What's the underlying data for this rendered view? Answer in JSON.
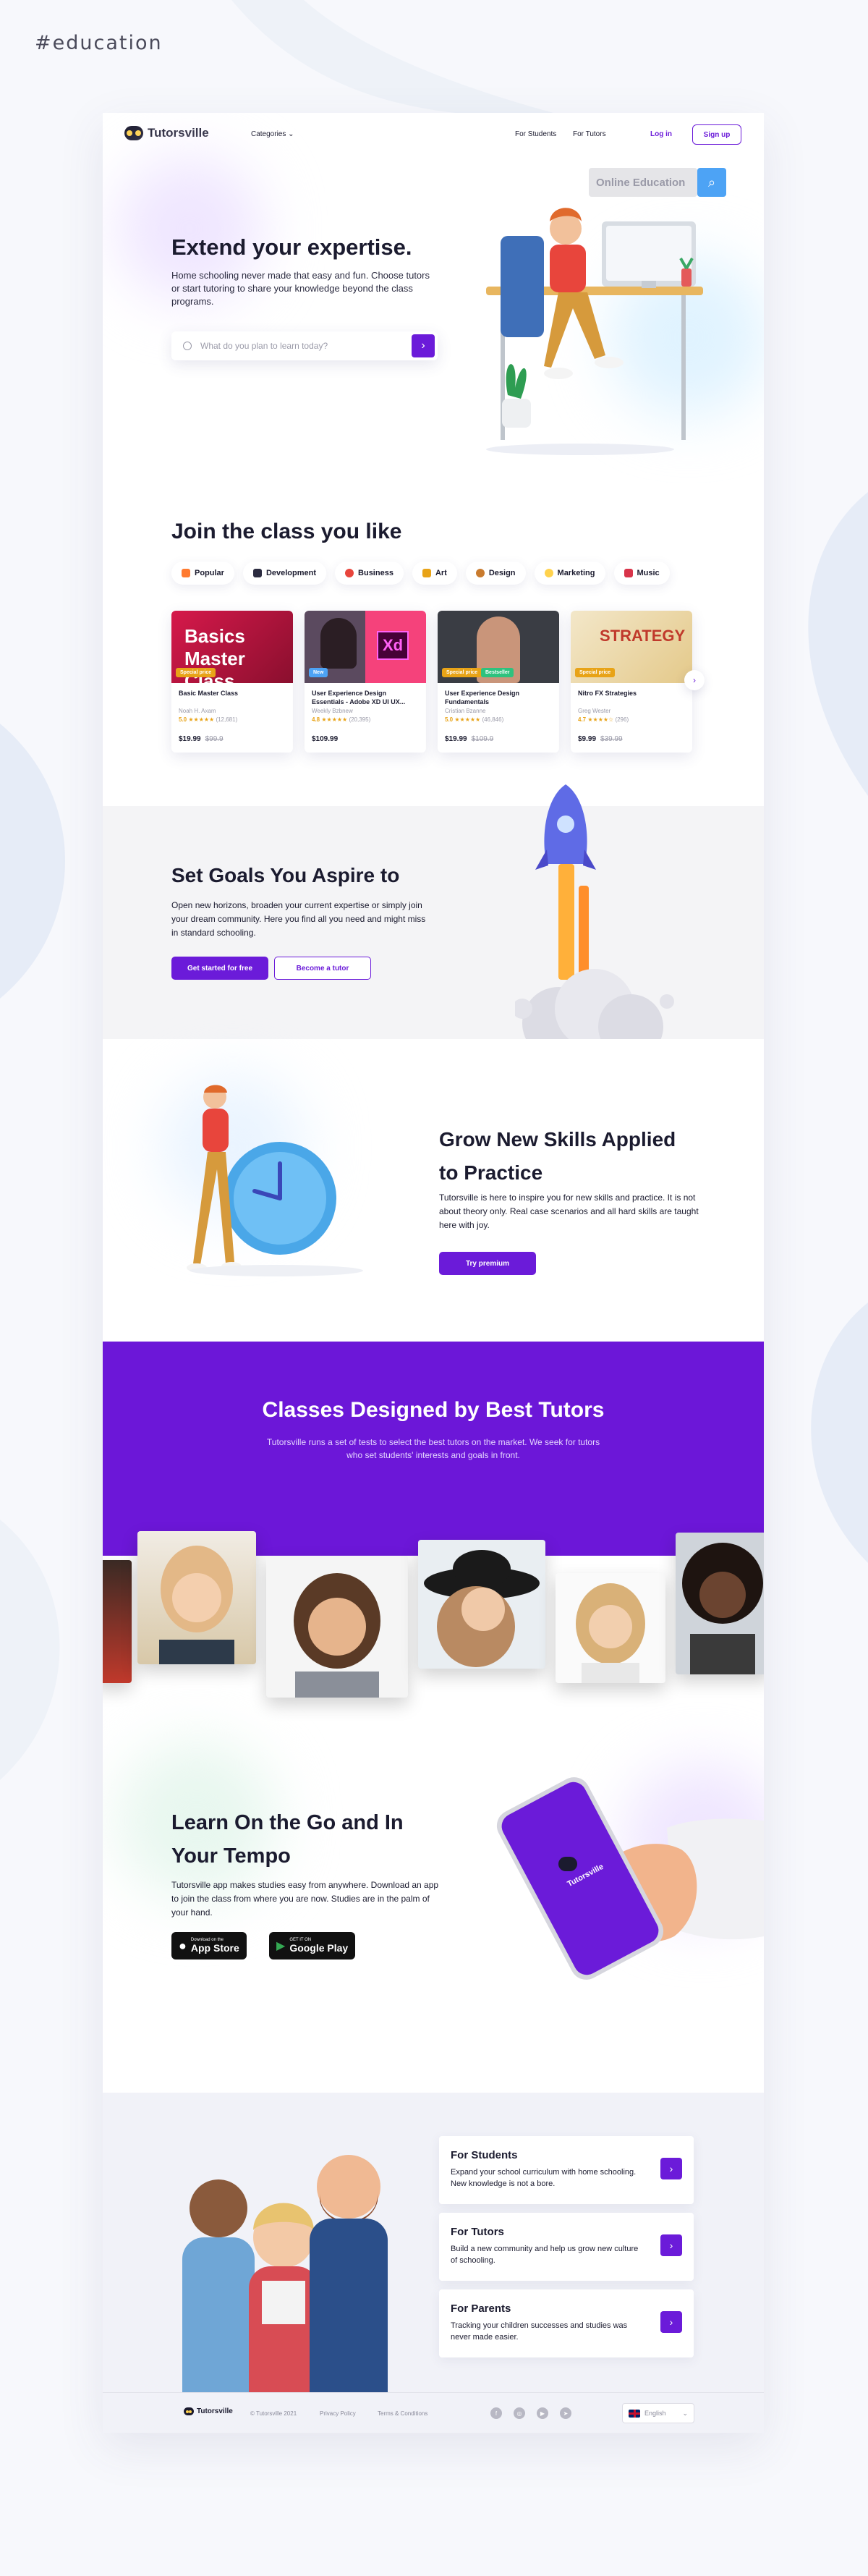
{
  "hashtag": "#education",
  "nav": {
    "logo": "Tutorsville",
    "categories": "Categories",
    "for_students": "For Students",
    "for_tutors": "For Tutors",
    "login": "Log in",
    "signup": "Sign up"
  },
  "hero": {
    "badge": "Online Education",
    "title": "Extend your expertise.",
    "subtitle": "Home schooling never made that easy and fun. Choose tutors or start tutoring to share your knowledge beyond the class programs.",
    "search_placeholder": "What do you plan to learn today?"
  },
  "classes": {
    "title": "Join the class you like",
    "categories": [
      "Popular",
      "Development",
      "Business",
      "Art",
      "Design",
      "Marketing",
      "Music"
    ],
    "cards": [
      {
        "title": "Basic Master Class",
        "author": "Noah H. Axam",
        "rating": "5.0",
        "reviews": "(12,681)",
        "price": "$19.99",
        "old_price": "$99.9",
        "tag": "Special price",
        "tag2": "",
        "image_text": "Basics Master Class"
      },
      {
        "title": "User Experience Design Essentials - Adobe XD UI UX...",
        "author": "Weekly Bzbnew",
        "rating": "4.8",
        "reviews": "(20,395)",
        "price": "$109.99",
        "old_price": "",
        "tag": "New",
        "tag2": "",
        "image_text": "Xd"
      },
      {
        "title": "User Experience Design Fundamentals",
        "author": "Cristian Bzanne",
        "rating": "5.0",
        "reviews": "(46,846)",
        "price": "$19.99",
        "old_price": "$109.9",
        "tag": "Special price",
        "tag2": "Bestseller",
        "image_text": ""
      },
      {
        "title": "Nitro FX Strategies",
        "author": "Greg Wester",
        "rating": "4.7",
        "reviews": "(296)",
        "price": "$9.99",
        "old_price": "$39.99",
        "tag": "Special price",
        "tag2": "",
        "image_text": "STRATEGY"
      }
    ]
  },
  "goals": {
    "title": "Set Goals You Aspire to",
    "text": "Open new horizons, broaden your current expertise or simply join your dream community. Here you find all you need and might miss in standard schooling.",
    "primary": "Get started for free",
    "secondary": "Become a tutor"
  },
  "skills": {
    "title": "Grow New Skills Applied to Practice",
    "text": "Tutorsville is here to inspire you for new skills and practice. It is not about theory only. Real case scenarios and all hard skills are taught here with joy.",
    "button": "Try premium"
  },
  "tutors": {
    "title": "Classes Designed by Best Tutors",
    "text": "Tutorsville runs a set of tests to select the best tutors on the market. We seek for tutors who set students' interests and goals in front."
  },
  "mobile": {
    "title": "Learn On the Go and In Your Tempo",
    "text": "Tutorsville app makes studies easy from anywhere. Download an app to join the class from where you are now. Studies are in the palm of your hand.",
    "appstore_small": "Download on the",
    "appstore_big": "App Store",
    "gplay_small": "GET IT ON",
    "gplay_big": "Google Play",
    "phone_logo": "Tutorsville"
  },
  "audience": [
    {
      "title": "For Students",
      "text": "Expand your school curriculum with home schooling. New knowledge is not a bore."
    },
    {
      "title": "For Tutors",
      "text": "Build a new community and help us grow new culture of schooling."
    },
    {
      "title": "For Parents",
      "text": "Tracking your children successes and studies was never made easier."
    }
  ],
  "footer": {
    "logo": "Tutorsville",
    "copyright": "© Tutorsville 2021",
    "privacy": "Privacy Policy",
    "terms": "Terms & Conditions",
    "language": "English"
  },
  "colors": {
    "accent": "#6b1bd9",
    "purple_section": "#6c17d8",
    "star": "#e8a317"
  }
}
